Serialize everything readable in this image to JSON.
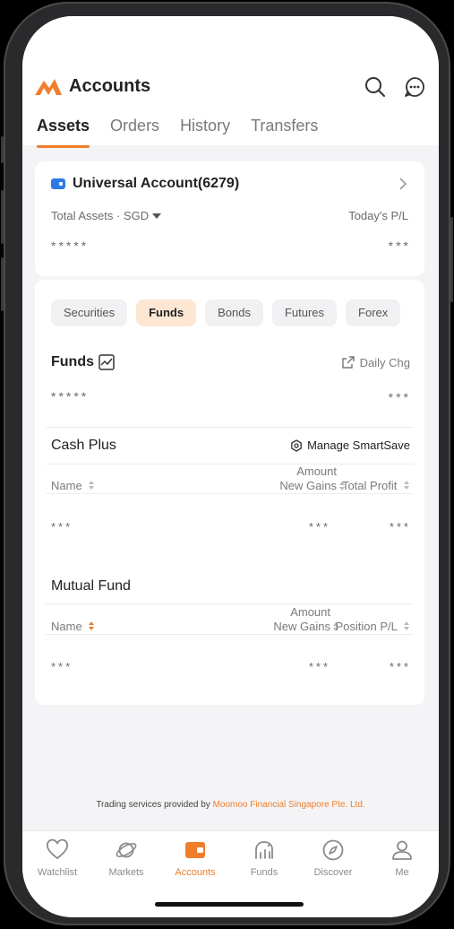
{
  "header": {
    "title": "Accounts"
  },
  "tabs": [
    {
      "label": "Assets"
    },
    {
      "label": "Orders"
    },
    {
      "label": "History"
    },
    {
      "label": "Transfers"
    }
  ],
  "account": {
    "name": "Universal Account(6279)",
    "total_assets_label": "Total Assets · SGD",
    "todays_pl_label": "Today's P/L",
    "total_assets_value": "*****",
    "todays_pl_value": "***"
  },
  "asset_tabs": [
    "Securities",
    "Funds",
    "Bonds",
    "Futures",
    "Forex"
  ],
  "funds": {
    "title": "Funds",
    "daily_chg_label": "Daily Chg",
    "total_value": "*****",
    "daily_chg_value": "***"
  },
  "cash_plus": {
    "title": "Cash Plus",
    "manage_label": "Manage SmartSave",
    "col_name": "Name",
    "col_amount": "Amount",
    "col_new_gains": "New Gains",
    "col_total_profit": "Total Profit",
    "row": {
      "name": "***",
      "amount": "***",
      "profit": "***"
    }
  },
  "mutual_fund": {
    "title": "Mutual Fund",
    "col_name": "Name",
    "col_amount": "Amount",
    "col_new_gains": "New Gains",
    "col_position_pl": "Position P/L",
    "row": {
      "name": "***",
      "amount": "***",
      "pl": "***"
    }
  },
  "footer": {
    "text": "Trading services provided by ",
    "link": "Moomoo Financial Singapore Pte. Ltd."
  },
  "bottom_nav": [
    {
      "label": "Watchlist",
      "icon": "heart-icon"
    },
    {
      "label": "Markets",
      "icon": "planet-icon"
    },
    {
      "label": "Accounts",
      "icon": "wallet-icon"
    },
    {
      "label": "Funds",
      "icon": "funds-icon"
    },
    {
      "label": "Discover",
      "icon": "compass-icon"
    },
    {
      "label": "Me",
      "icon": "person-icon"
    }
  ],
  "colors": {
    "accent": "#f07d2b",
    "account_icon": "#2c7be5",
    "active_pill_bg": "#fde7d3"
  }
}
